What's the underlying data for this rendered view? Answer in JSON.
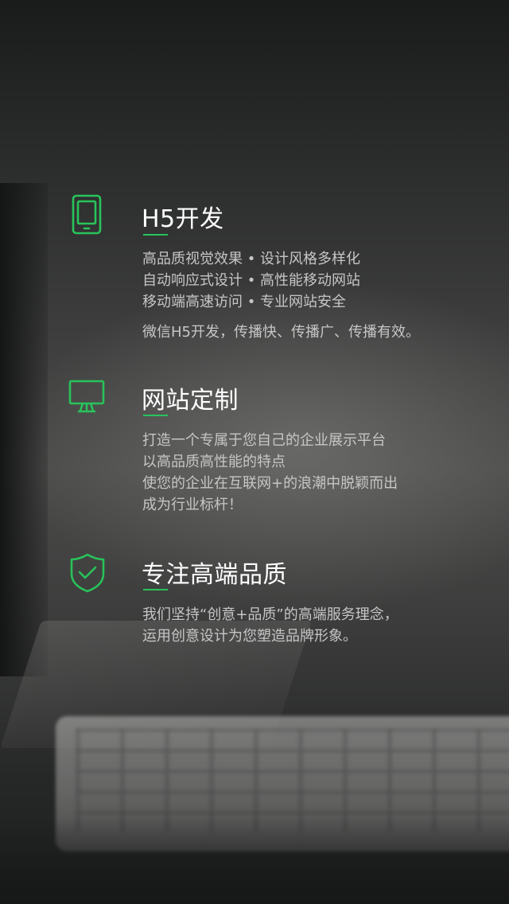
{
  "accent_color": "#28c35a",
  "sections": [
    {
      "icon": "tablet-icon",
      "title": "H5开发",
      "lines": [
        "高品质视觉效果 • 设计风格多样化",
        "自动响应式设计 • 高性能移动网站",
        "移动端高速访问 • 专业网站安全"
      ],
      "tagline": "微信H5开发，传播快、传播广、传播有效。"
    },
    {
      "icon": "monitor-icon",
      "title": "网站定制",
      "lines": [
        "打造一个专属于您自己的企业展示平台",
        "以高品质高性能的特点",
        "使您的企业在互联网+的浪潮中脱颖而出",
        "成为行业标杆！"
      ]
    },
    {
      "icon": "shield-check-icon",
      "title": "专注高端品质",
      "lines": [
        "我们坚持“创意+品质”的高端服务理念，",
        "运用创意设计为您塑造品牌形象。"
      ]
    }
  ]
}
